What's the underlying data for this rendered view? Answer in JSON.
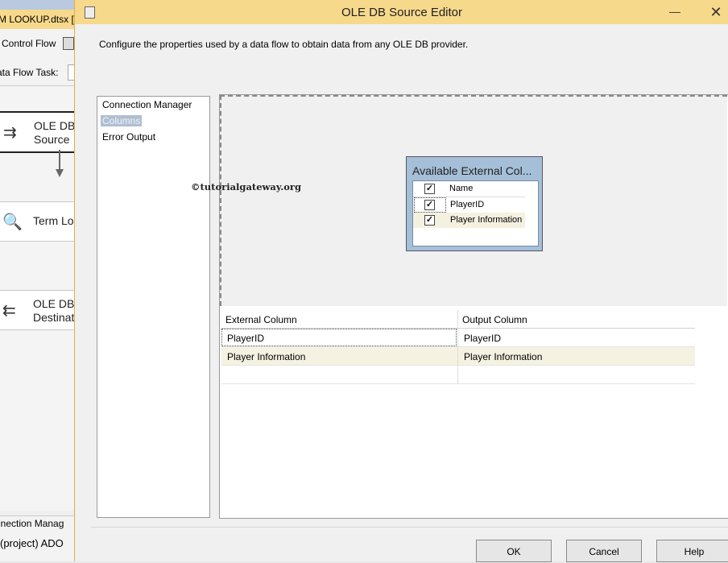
{
  "background": {
    "tab_title": "M LOOKUP.dtsx [D",
    "control_flow_label": "Control Flow",
    "data_flow_task_label": "ata Flow Task:",
    "nodes": [
      {
        "line1": "OLE DB",
        "line2": "Source"
      },
      {
        "line1": "Term Lo",
        "line2": ""
      },
      {
        "line1": "OLE DB",
        "line2": "Destinat"
      }
    ],
    "connection_managers_label": "nnection Manag",
    "connection_item": "(project) ADO"
  },
  "dialog": {
    "title": "OLE DB Source Editor",
    "minimize": "—",
    "close": "✕",
    "description": "Configure the properties used by a data flow to obtain data from any OLE DB provider.",
    "nav": [
      {
        "label": "Connection Manager",
        "selected": false
      },
      {
        "label": "Columns",
        "selected": true
      },
      {
        "label": "Error Output",
        "selected": false
      }
    ],
    "watermark": "©tutorialgateway.org",
    "available_columns": {
      "header": "Available External Col...",
      "name_header": "Name",
      "items": [
        {
          "label": "PlayerID",
          "checked": true
        },
        {
          "label": "Player Information",
          "checked": true
        }
      ]
    },
    "mapping_grid": {
      "headers": [
        "External Column",
        "Output Column"
      ],
      "rows": [
        {
          "external": "PlayerID",
          "output": "PlayerID"
        },
        {
          "external": "Player Information",
          "output": "Player Information"
        }
      ]
    },
    "buttons": {
      "ok": "OK",
      "cancel": "Cancel",
      "help": "Help"
    }
  },
  "colors": {
    "titlebar": "#f7d98c",
    "selected_nav": "#b0bfd2",
    "available_panel": "#a5bfd8",
    "highlight_row": "#f6f2e2"
  }
}
